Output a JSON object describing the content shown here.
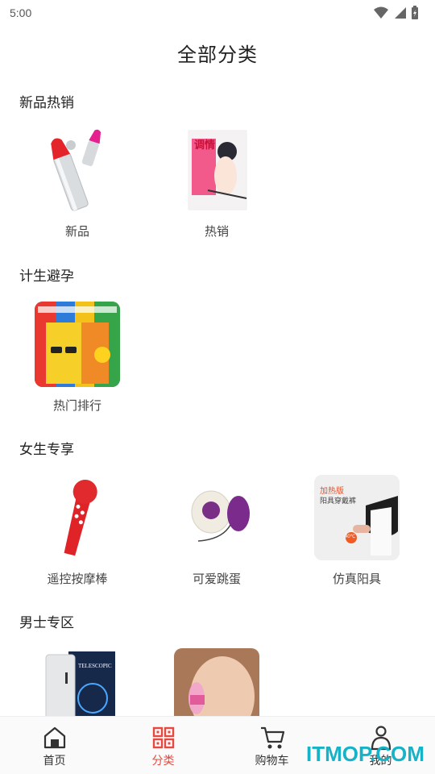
{
  "status": {
    "time": "5:00"
  },
  "page_title": "全部分类",
  "sections": [
    {
      "title": "新品热销",
      "items": [
        {
          "label": "新品"
        },
        {
          "label": "热销"
        }
      ]
    },
    {
      "title": "计生避孕",
      "items": [
        {
          "label": "热门排行"
        }
      ]
    },
    {
      "title": "女生专享",
      "items": [
        {
          "label": "遥控按摩棒"
        },
        {
          "label": "可爱跳蛋"
        },
        {
          "label": "仿真阳具"
        }
      ]
    },
    {
      "title": "男士专区",
      "items": [
        {
          "label": ""
        },
        {
          "label": ""
        }
      ]
    }
  ],
  "thumb_text": {
    "manga_title": "调情",
    "heat_banner": "加热版",
    "heat_subtitle": "阳具穿戴裤",
    "heat_temp": "40℃",
    "box_brand": "TELESCOPIC"
  },
  "bottom_nav": [
    {
      "label": "首页",
      "icon": "home-icon"
    },
    {
      "label": "分类",
      "icon": "category-grid-icon"
    },
    {
      "label": "购物车",
      "icon": "cart-icon"
    },
    {
      "label": "我的",
      "icon": "user-icon"
    }
  ],
  "watermark": "ITMOP.COM",
  "colors": {
    "accent": "#e5493f",
    "watermark": "#16b3c8"
  }
}
